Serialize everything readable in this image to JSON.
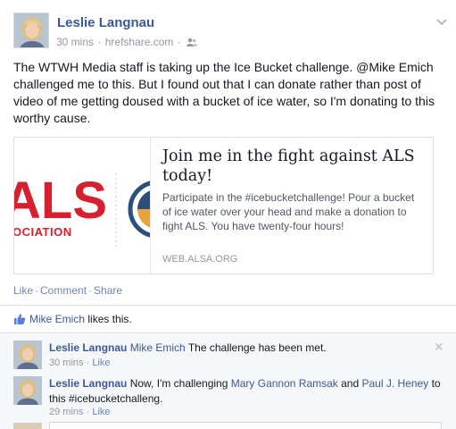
{
  "post": {
    "author": "Leslie Langnau",
    "time": "30 mins",
    "source": "hrefshare.com",
    "dot": "·",
    "text": "The WTWH Media staff is taking up the Ice Bucket challenge. @Mike Emich challenged me to this. But I found out that I can donate rather than post of video of me getting doused with a bucket of ice water, so I'm donating to this worthy cause."
  },
  "card": {
    "title": "Join me in the fight against ALS today!",
    "description": "Participate in the #icebucketchallenge! Pour a bucket of ice water over your head and make a donation to fight ALS. You have twenty-four hours!",
    "domain": "WEB.ALSA.ORG",
    "image_text_1": "ALS",
    "image_text_2": "OCIATION"
  },
  "actions": {
    "like": "Like",
    "comment": "Comment",
    "share": "Share",
    "sep": "·"
  },
  "likes": {
    "name": "Mike Emich",
    "suffix": "likes this."
  },
  "comments": [
    {
      "author": "Leslie Langnau",
      "mention": "Mike Emich",
      "text": "The challenge has been met.",
      "time": "30 mins",
      "like": "Like"
    },
    {
      "author": "Leslie Langnau",
      "text_before": "Now, I'm challenging",
      "mention1": "Mary Gannon Ramsak",
      "and": "and",
      "mention2": "Paul J. Heney",
      "text_after": "to this #icebucketchalleng.",
      "time": "29 mins",
      "like": "Like"
    }
  ],
  "colors": {
    "link": "#3b5998",
    "meta": "#9197a3",
    "als_red": "#d6202f"
  },
  "icons": {
    "friends": "friends-icon",
    "chevron": "chevron-down-icon",
    "thumb": "thumbs-up-icon",
    "close": "close-icon"
  },
  "close_glyph": "✕"
}
